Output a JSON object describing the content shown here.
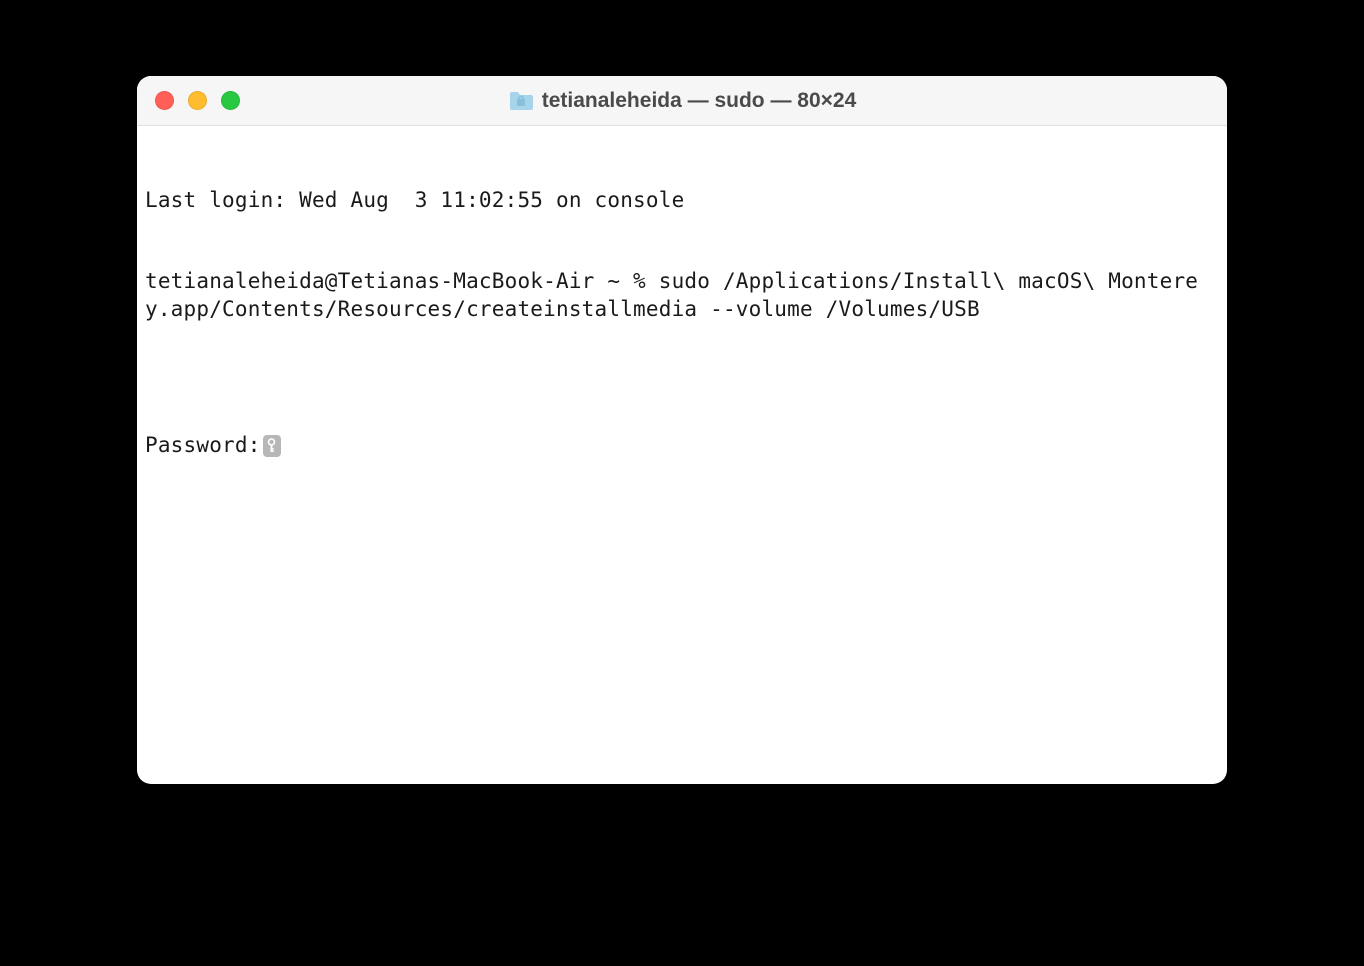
{
  "window": {
    "title": "tetianaleheida — sudo — 80×24"
  },
  "terminal": {
    "last_login": "Last login: Wed Aug  3 11:02:55 on console",
    "prompt_and_command": "tetianaleheida@Tetianas-MacBook-Air ~ % sudo /Applications/Install\\ macOS\\ Monterey.app/Contents/Resources/createinstallmedia --volume /Volumes/USB",
    "blank": "",
    "password_label": "Password:"
  }
}
